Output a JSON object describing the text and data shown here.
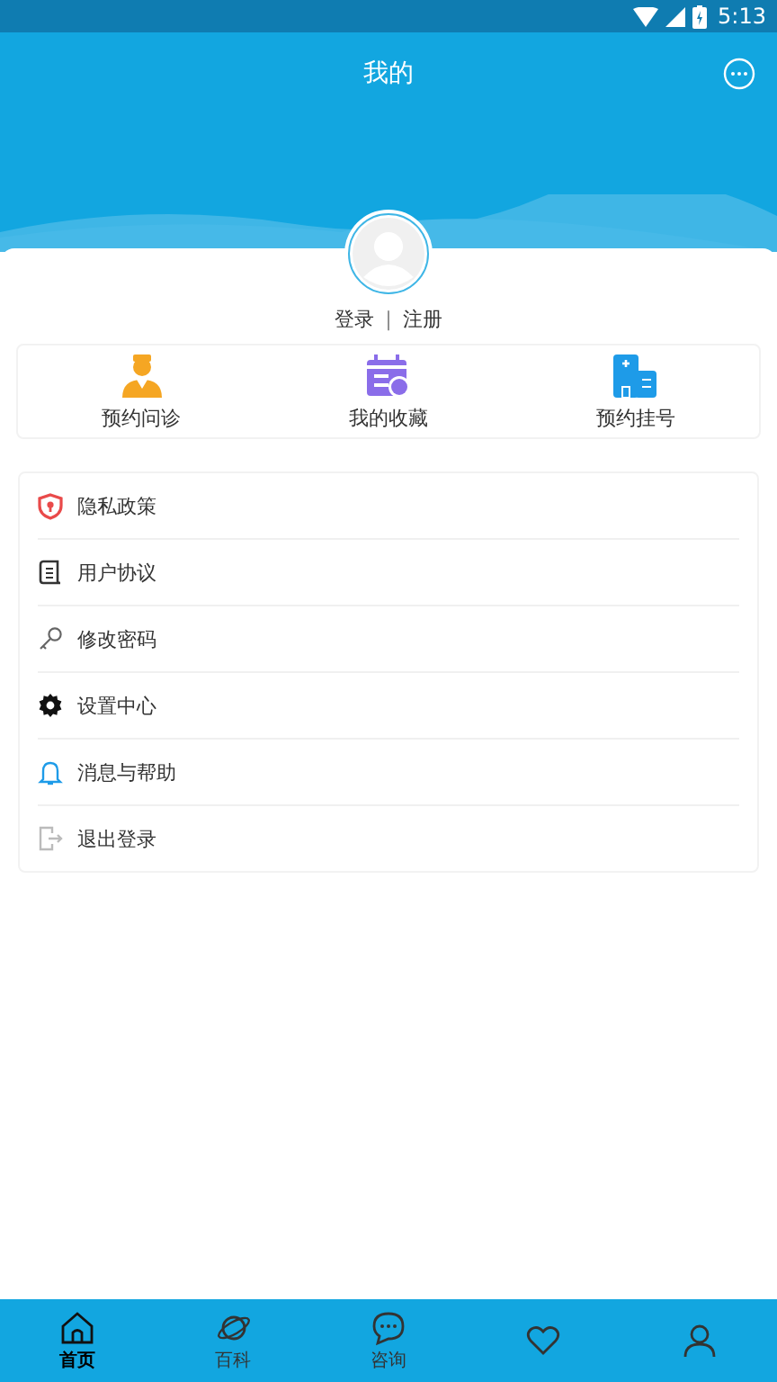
{
  "status_bar": {
    "time": "5:13"
  },
  "header": {
    "title": "我的"
  },
  "profile": {
    "login": "登录",
    "separator": "|",
    "register": "注册"
  },
  "shortcuts": [
    {
      "kind": "doctor",
      "label": "预约问诊"
    },
    {
      "kind": "calendar",
      "label": "我的收藏"
    },
    {
      "kind": "hospital",
      "label": "预约挂号"
    }
  ],
  "menu": [
    {
      "kind": "shield",
      "label": "隐私政策"
    },
    {
      "kind": "document",
      "label": "用户协议"
    },
    {
      "kind": "key",
      "label": "修改密码"
    },
    {
      "kind": "gear",
      "label": "设置中心"
    },
    {
      "kind": "bell",
      "label": "消息与帮助"
    },
    {
      "kind": "logout",
      "label": "退出登录"
    }
  ],
  "tab_bar": [
    {
      "kind": "home",
      "label": "首页",
      "selected": true
    },
    {
      "kind": "planet",
      "label": "百科",
      "selected": false
    },
    {
      "kind": "chat",
      "label": "咨询",
      "selected": false
    },
    {
      "kind": "heart",
      "selected": false
    },
    {
      "kind": "person",
      "selected": false
    }
  ]
}
